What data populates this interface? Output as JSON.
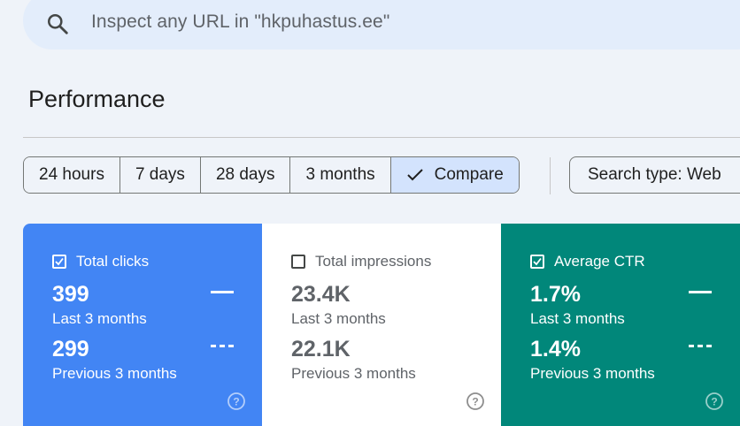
{
  "search": {
    "placeholder": "Inspect any URL in \"hkpuhastus.ee\""
  },
  "page": {
    "title": "Performance"
  },
  "date_range": {
    "options": [
      {
        "label": "24 hours",
        "active": false
      },
      {
        "label": "7 days",
        "active": false
      },
      {
        "label": "28 days",
        "active": false
      },
      {
        "label": "3 months",
        "active": false
      },
      {
        "label": "Compare",
        "active": true
      }
    ]
  },
  "search_type": {
    "label": "Search type: Web"
  },
  "metrics": {
    "clicks": {
      "title": "Total clicks",
      "checked": true,
      "color": "#4285f4",
      "value_current": "399",
      "label_current": "Last 3 months",
      "value_previous": "299",
      "label_previous": "Previous 3 months"
    },
    "impressions": {
      "title": "Total impressions",
      "checked": false,
      "color": "#ffffff",
      "value_current": "23.4K",
      "label_current": "Last 3 months",
      "value_previous": "22.1K",
      "label_previous": "Previous 3 months"
    },
    "ctr": {
      "title": "Average CTR",
      "checked": true,
      "color": "#01877a",
      "value_current": "1.7%",
      "label_current": "Last 3 months",
      "value_previous": "1.4%",
      "label_previous": "Previous 3 months"
    }
  },
  "icons": {
    "search": "search-icon",
    "check": "check-icon",
    "help": "help-icon"
  }
}
